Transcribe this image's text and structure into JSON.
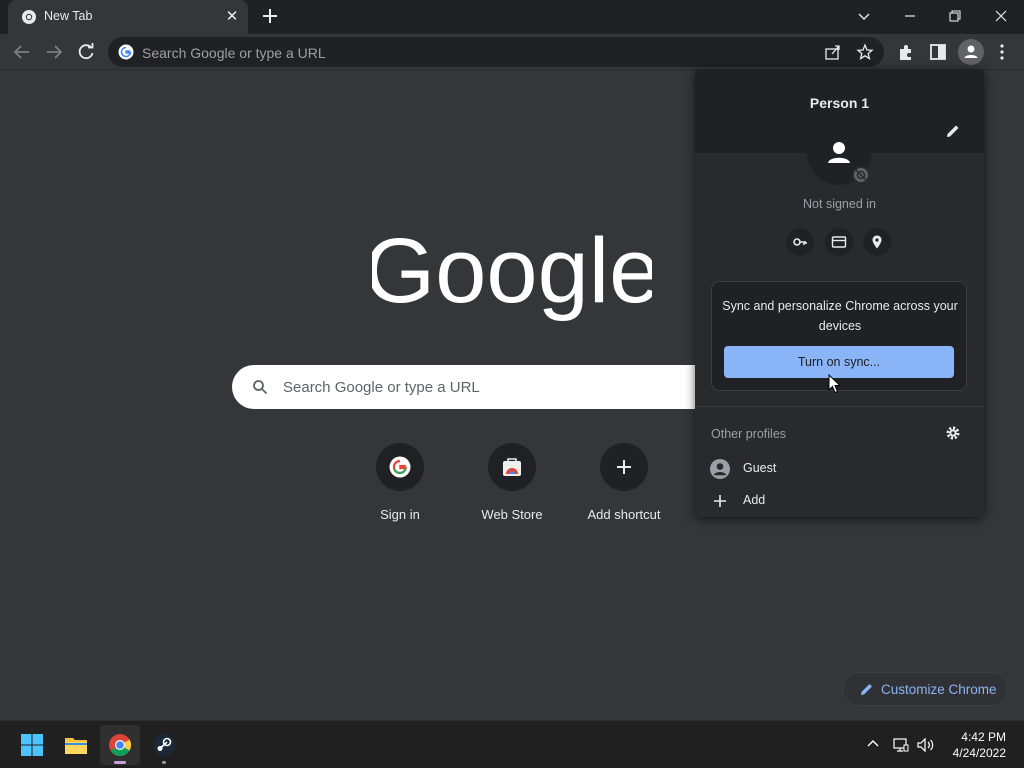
{
  "tab": {
    "title": "New Tab",
    "close_icon": "close-icon"
  },
  "toolbar": {
    "omnibox_placeholder": "Search Google or type a URL"
  },
  "ntp": {
    "logo_text": "Google",
    "search_placeholder": "Search Google or type a URL",
    "shortcuts": [
      {
        "label": "Sign in",
        "icon": "google-g-icon"
      },
      {
        "label": "Web Store",
        "icon": "web-store-icon"
      },
      {
        "label": "Add shortcut",
        "icon": "plus-icon"
      }
    ],
    "customize_label": "Customize Chrome"
  },
  "profile_popup": {
    "name": "Person 1",
    "status": "Not signed in",
    "sync_text": "Sync and personalize Chrome across your devices",
    "sync_button": "Turn on sync...",
    "other_profiles_label": "Other profiles",
    "profiles": [
      {
        "label": "Guest",
        "icon": "guest-avatar-icon"
      },
      {
        "label": "Add",
        "icon": "plus-icon"
      }
    ]
  },
  "taskbar": {
    "time": "4:42 PM",
    "date": "4/24/2022"
  },
  "colors": {
    "accent": "#8ab4f8",
    "background": "#35363a",
    "popup": "#292a2d"
  }
}
